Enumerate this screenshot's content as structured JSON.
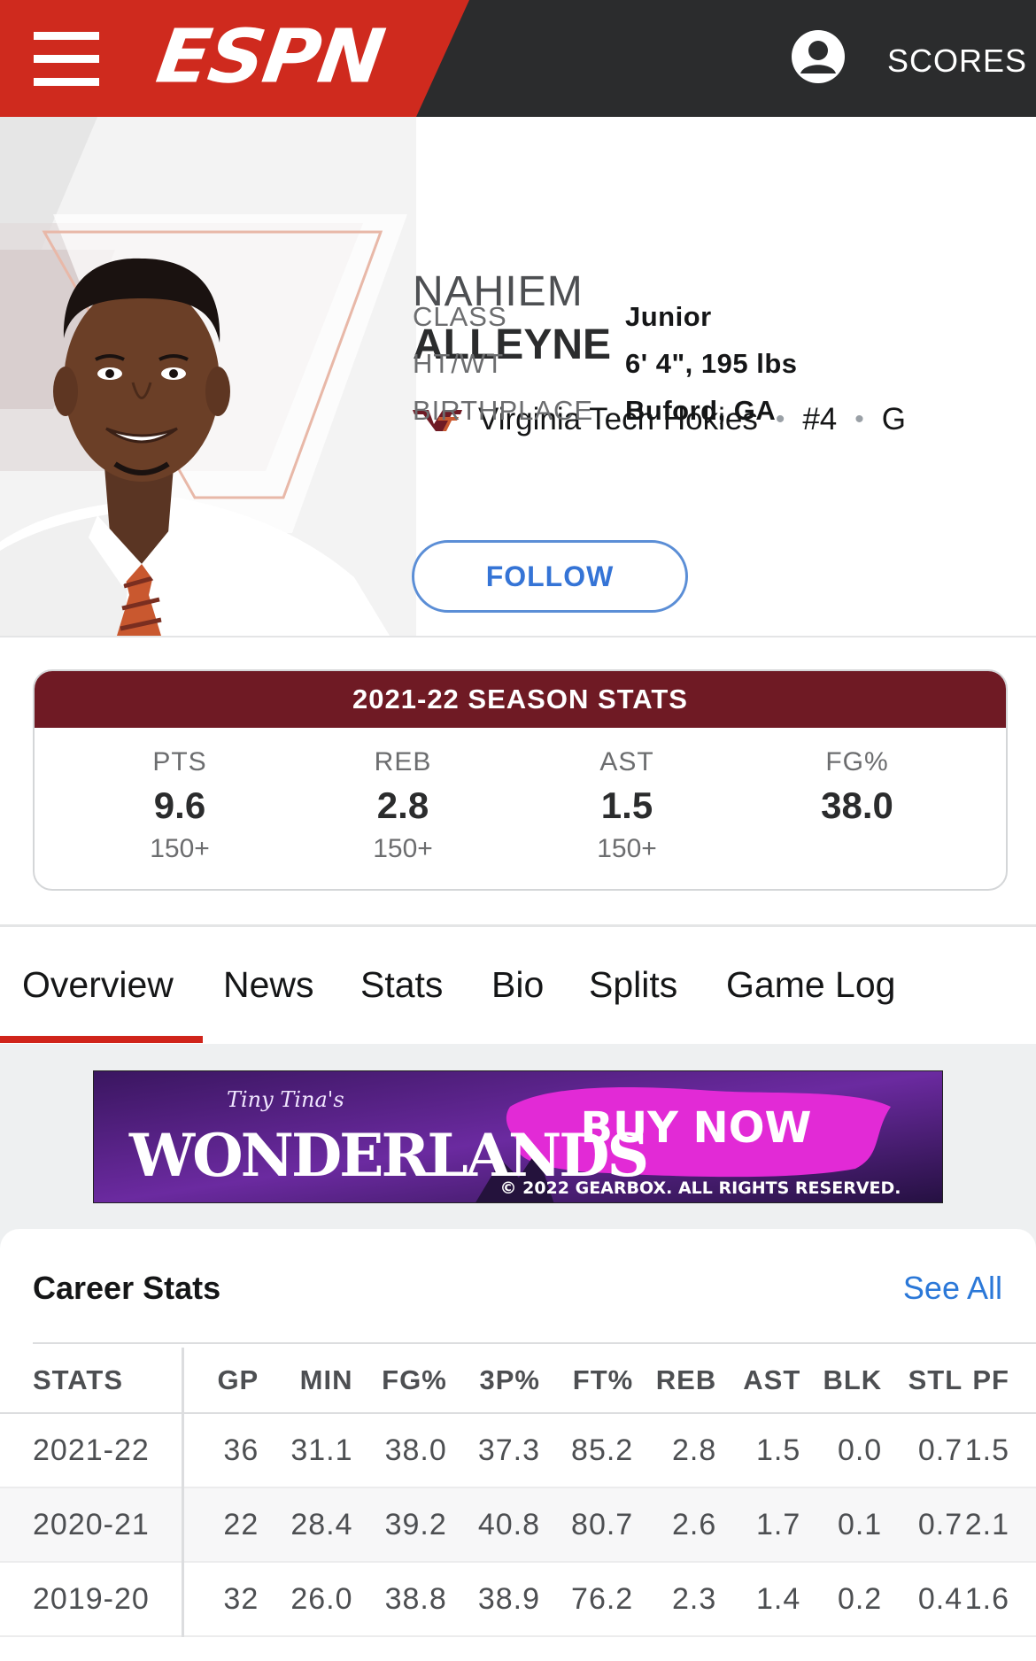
{
  "nav": {
    "brand": "ESPN",
    "scores_label": "SCORES",
    "icons": [
      "menu-icon",
      "user-icon"
    ]
  },
  "player": {
    "first_name": "NAHIEM",
    "last_name": "ALLEYNE",
    "team": "Virginia Tech Hokies",
    "team_logo_text": "VT",
    "number": "#4",
    "position": "G",
    "bio": [
      {
        "label": "CLASS",
        "value": "Junior"
      },
      {
        "label": "HT/WT",
        "value": "6' 4\", 195 lbs"
      },
      {
        "label": "BIRTHPLACE",
        "value": "Buford, GA"
      }
    ],
    "follow_label": "FOLLOW"
  },
  "season_stats": {
    "title": "2021-22 SEASON STATS",
    "accent_color": "#6f1a24",
    "stats": [
      {
        "abbr": "PTS",
        "value": "9.6",
        "rank": "150+"
      },
      {
        "abbr": "REB",
        "value": "2.8",
        "rank": "150+"
      },
      {
        "abbr": "AST",
        "value": "1.5",
        "rank": "150+"
      },
      {
        "abbr": "FG%",
        "value": "38.0",
        "rank": ""
      }
    ]
  },
  "tabs": {
    "active_color": "#d0241b",
    "items": [
      {
        "label": "Overview",
        "active": true
      },
      {
        "label": "News",
        "active": false
      },
      {
        "label": "Stats",
        "active": false
      },
      {
        "label": "Bio",
        "active": false
      },
      {
        "label": "Splits",
        "active": false
      },
      {
        "label": "Game Log",
        "active": false
      }
    ]
  },
  "ad": {
    "brand_small": "Tiny Tina's",
    "brand_large": "WONDERLANDS",
    "cta": "BUY NOW",
    "copyright": "© 2022 GEARBOX. ALL RIGHTS RESERVED."
  },
  "career": {
    "title": "Career Stats",
    "see_all": "See All",
    "columns": [
      "STATS",
      "GP",
      "MIN",
      "FG%",
      "3P%",
      "FT%",
      "REB",
      "AST",
      "BLK",
      "STL",
      "PF"
    ],
    "rows": [
      [
        "2021-22",
        "36",
        "31.1",
        "38.0",
        "37.3",
        "85.2",
        "2.8",
        "1.5",
        "0.0",
        "0.7",
        "1.5"
      ],
      [
        "2020-21",
        "22",
        "28.4",
        "39.2",
        "40.8",
        "80.7",
        "2.6",
        "1.7",
        "0.1",
        "0.7",
        "2.1"
      ],
      [
        "2019-20",
        "32",
        "26.0",
        "38.8",
        "38.9",
        "76.2",
        "2.3",
        "1.4",
        "0.2",
        "0.4",
        "1.6"
      ]
    ]
  }
}
